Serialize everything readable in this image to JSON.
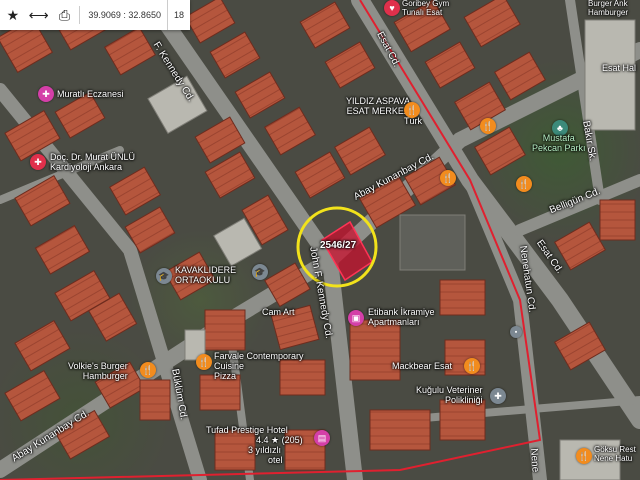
{
  "toolbar": {
    "star_icon": "star-icon",
    "move_icon": "arrows-horizontal-icon",
    "print_icon": "printer-icon",
    "coordinates": "39.9069 : 32.8650",
    "zoom": "18"
  },
  "streets": {
    "kennedy_top": "F. Kennedy Cd.",
    "kennedy_mid": "John F. Kennedy Cd.",
    "abay_east": "Abay Kunanbay Cd.",
    "abay_west": "Abay Kunanbay Cd.",
    "esat": "Esat Cd.",
    "esat_lower": "Esat Cd.",
    "bakir": "Bakır Sk.",
    "belligun": "Belligün Cd.",
    "nenehatun": "Nenehatun Cd.",
    "nenehatun_bottom": "Nene",
    "buklum": "Büklüm Cd."
  },
  "places": {
    "gym_line1": "Goribey Gym",
    "gym_line2": "Tunalı Esat",
    "burger": "Burger Ank",
    "burger_sub": "Hamburger",
    "esat_hal": "Esat Hal",
    "murati": "Muratlı Eczanesi",
    "yildiz_line1": "YILDIZ ASPAVA",
    "yildiz_line2": "ESAT MERKEZ",
    "yildiz_sub": "Türk",
    "park_line1": "Mustafa",
    "park_line2": "Pekcan Parkı",
    "doc_line1": "Doç. Dr. Murat ÜNLÜ",
    "doc_line2": "Kardiyoloji Ankara",
    "school_line1": "KAVAKLIDERE",
    "school_line2": "ORTAOKULU",
    "camart": "Cam Art",
    "etibank_line1": "Etibank İkramiye",
    "etibank_line2": "Apartmanları",
    "farvale_line1": "Farvale Contemporary",
    "farvale_line2": "Cuisine",
    "farvale_sub": "Pizza",
    "volkies": "Volkie's Burger",
    "volkies_sub": "Hamburger",
    "mackbear": "Mackbear Esat",
    "kugulu_line1": "Kuğulu Veteriner",
    "kugulu_line2": "Polikliniği",
    "tufad": "Tufad Prestige Hotel",
    "tufad_rating": "4.4 ★ (205)",
    "tufad_sub1": "3 yıldızlı",
    "tufad_sub2": "otel",
    "goksu_line1": "Göksu Rest",
    "goksu_line2": "Nene Hatu"
  },
  "parcel": {
    "label": "2546/27"
  },
  "colors": {
    "highlight_circle": "#f2e21b",
    "parcel_fill": "#c8102e",
    "boundary_line": "#e0202f",
    "poi_orange": "#f28c1e",
    "poi_pink": "#d43fa8",
    "road": "#8e8f8a"
  }
}
